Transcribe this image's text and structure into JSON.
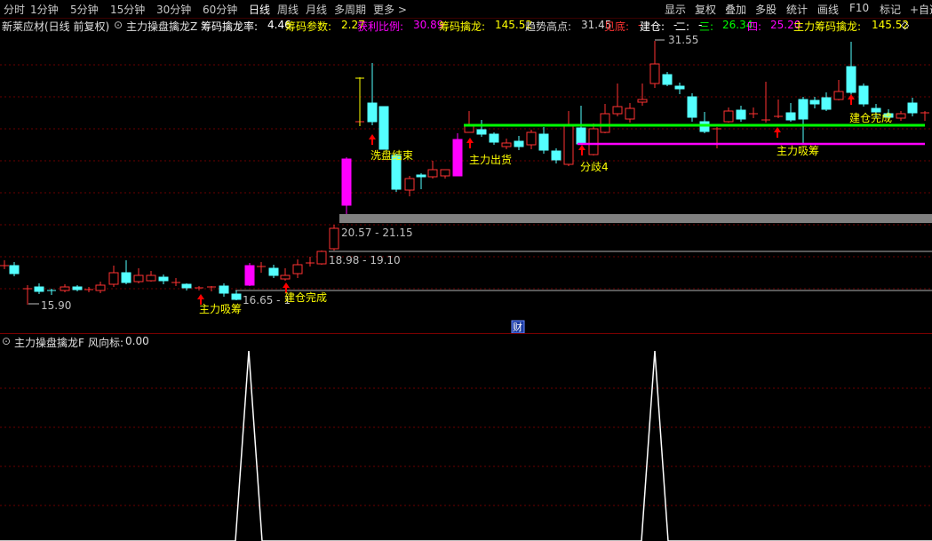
{
  "toolbar": {
    "periods": [
      "分时",
      "1分钟",
      "5分钟",
      "15分钟",
      "30分钟",
      "60分钟",
      "日线",
      "周线",
      "月线",
      "多周期",
      "更多 >"
    ],
    "active_period": "日线",
    "tools": [
      "显示",
      "复权",
      "叠加",
      "多股",
      "统计",
      "画线",
      "F10",
      "标记",
      "+自选"
    ]
  },
  "infobar": {
    "stock": "新莱应材(日线 前复权)",
    "indicator": "主力操盘擒龙Z",
    "items": [
      {
        "label": "筹码擒龙率:",
        "value": "4.46",
        "label_color": "#ffffff",
        "value_color": "#ffffff"
      },
      {
        "label": "筹码参数:",
        "value": "2.27",
        "label_color": "#ffff00",
        "value_color": "#ffff00"
      },
      {
        "label": "获利比例:",
        "value": "30.89",
        "label_color": "#ff00ff",
        "value_color": "#ff00ff"
      },
      {
        "label": "筹码擒龙:",
        "value": "145.52",
        "label_color": "#ffff00",
        "value_color": "#ffff00"
      },
      {
        "label": "趋势高点:",
        "value": "31.45",
        "label_color": "#d0d0d0",
        "value_color": "#d0d0d0"
      },
      {
        "label": "见底:",
        "value": "-",
        "label_color": "#ff3232",
        "value_color": "#ff3232"
      },
      {
        "label": "建仓:",
        "value": "-",
        "label_color": "#ffffff",
        "value_color": "#ffffff"
      },
      {
        "label": "二:",
        "value": "-",
        "label_color": "#ffffff",
        "value_color": "#ffffff"
      },
      {
        "label": "三:",
        "value": "26.34",
        "label_color": "#00ff00",
        "value_color": "#00ff00"
      },
      {
        "label": "四:",
        "value": "25.20",
        "label_color": "#ff00ff",
        "value_color": "#ff00ff"
      },
      {
        "label": "主力筹码擒龙:",
        "value": "145.52",
        "label_color": "#ffff00",
        "value_color": "#ffff00"
      }
    ]
  },
  "main_chart": {
    "price_labels": {
      "high": "31.55",
      "low": "15.90"
    },
    "zones": [
      "20.57 - 21.15",
      "18.98 - 19.10",
      "16.65 - 1"
    ],
    "signals": [
      "洗盘结束",
      "主力出货",
      "分歧4",
      "主力吸筹",
      "建仓完成",
      "主力吸筹",
      "建仓完成"
    ],
    "finance_badge": "财"
  },
  "sub_chart": {
    "indicator": "主力操盘擒龙F",
    "label": "风向标:",
    "value": "0.00"
  },
  "colors": {
    "up": "#ff3232",
    "down": "#54ffff",
    "strong_up": "#ff00ff",
    "base_line": "#00ff00",
    "support_line": "#ff00ff",
    "zone_fill": "#808080",
    "signal_text": "#ffff00",
    "arrow": "#ff0000"
  }
}
